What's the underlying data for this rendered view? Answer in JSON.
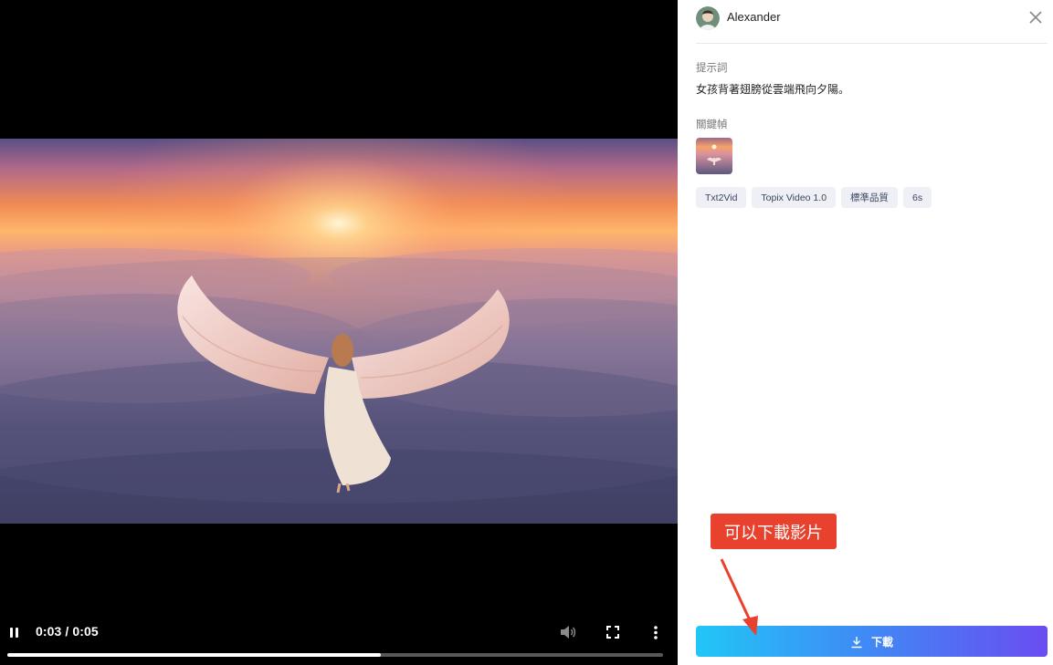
{
  "player": {
    "time_display": "0:03 / 0:05",
    "progress_fraction": 0.57,
    "state": "playing"
  },
  "details": {
    "username": "Alexander",
    "prompt_label": "提示詞",
    "prompt_text": "女孩背著翅膀從雲端飛向夕陽。",
    "keyframe_label": "關鍵幀",
    "tags": [
      "Txt2Vid",
      "Topix Video 1.0",
      "標準品質",
      "6s"
    ],
    "download_label": "下載"
  },
  "annotation": {
    "callout_text": "可以下載影片",
    "color": "#e8412d"
  },
  "colors": {
    "download_gradient_start": "#22c6f6",
    "download_gradient_end": "#6a4cf2",
    "tag_bg": "#eef0f5"
  },
  "icons": [
    "pause-icon",
    "volume-icon",
    "fullscreen-icon",
    "more-vert-icon",
    "close-icon",
    "download-icon"
  ]
}
